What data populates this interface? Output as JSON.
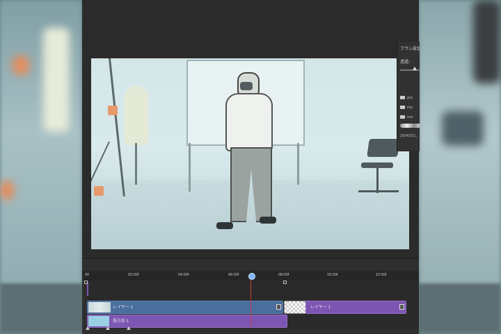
{
  "panel": {
    "title": "ブラシ設定",
    "opacity_label": "透過：",
    "folders": [
      "gou",
      "imp",
      "runi"
    ],
    "preset_name": "20240221_"
  },
  "timeline": {
    "ruler_labels": [
      "00",
      "02:00f",
      "04:00f",
      "06:00f",
      "08:00f",
      "10:00f",
      "12:00f"
    ],
    "tracks": [
      {
        "clips": [
          {
            "label": "レイヤー 1",
            "color": "#4a6e9e"
          },
          {
            "label": "レイヤー 1",
            "color": "#7d56b3"
          }
        ]
      },
      {
        "clips": [
          {
            "label": "長方形 1",
            "color": "#7d56b3"
          }
        ]
      }
    ],
    "playhead_color": "#c53a3a"
  },
  "colors": {
    "app_bg": "#2b2b2b",
    "clip_blue": "#4a6e9e",
    "clip_purple": "#7d56b3",
    "playhead_knob": "#7fb8ff"
  }
}
